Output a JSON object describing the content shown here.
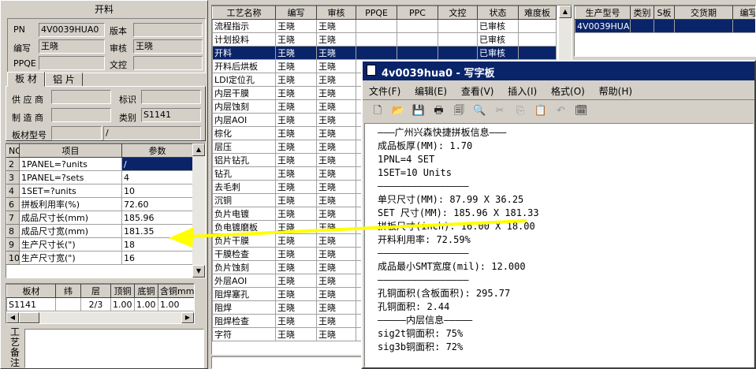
{
  "left": {
    "title": "开料",
    "pn_label": "PN",
    "pn_value": "4V0039HUA0",
    "version_label": "版本",
    "version_value": "",
    "editor_label": "编写",
    "editor_value": "王晓",
    "reviewer_label": "审核",
    "reviewer_value": "王晓",
    "ppqe_label": "PPQE",
    "ppqe_value": "",
    "doc_label": "文控",
    "doc_value": "",
    "tabs": [
      "板 材",
      "铝 片"
    ],
    "supplier_label": "供 应 商",
    "supplier_value": "",
    "mark_label": "标识",
    "mark_value": "",
    "maker_label": "制 造 商",
    "maker_value": "",
    "category_label": "类别",
    "category_value": "S1141",
    "model_label": "板材型号",
    "model_value": "",
    "model_value2": "/",
    "param_headers": [
      "NO",
      "项目",
      "参数"
    ],
    "params": [
      {
        "no": "2",
        "item": "1PANEL=?units",
        "value": "/"
      },
      {
        "no": "3",
        "item": "1PANEL=?sets",
        "value": "4"
      },
      {
        "no": "4",
        "item": "1SET=?units",
        "value": "10"
      },
      {
        "no": "6",
        "item": "拼板利用率(%)",
        "value": "72.60"
      },
      {
        "no": "7",
        "item": "成品尺寸长(mm)",
        "value": "185.96"
      },
      {
        "no": "8",
        "item": "成品尺寸宽(mm)",
        "value": "181.35"
      },
      {
        "no": "9",
        "item": "生产尺寸长(\")",
        "value": "18"
      },
      {
        "no": "10",
        "item": "生产尺寸宽(\")",
        "value": "16"
      }
    ],
    "material_headers": [
      "板材",
      "纬",
      "层",
      "顶铜",
      "底铜",
      "含铜mm"
    ],
    "material_row": [
      "S1141",
      "",
      "2/3",
      "1.00",
      "1.00",
      "1.00"
    ],
    "remarks_label": "工艺备注"
  },
  "process": {
    "headers": [
      "工艺名称",
      "编写",
      "审核",
      "PPQE",
      "PPC",
      "文控",
      "状态",
      "难度板"
    ],
    "rows": [
      {
        "name": "流程指示",
        "editor": "王晓",
        "reviewer": "王晓",
        "status": "已审核"
      },
      {
        "name": "计划投料",
        "editor": "王晓",
        "reviewer": "王晓",
        "status": "已审核"
      },
      {
        "name": "开料",
        "editor": "王晓",
        "reviewer": "王晓",
        "status": "已审核"
      },
      {
        "name": "开料后烘板",
        "editor": "王晓",
        "reviewer": "王晓",
        "status": ""
      },
      {
        "name": "LDI定位孔",
        "editor": "王晓",
        "reviewer": "王晓",
        "status": ""
      },
      {
        "name": "内层干膜",
        "editor": "王晓",
        "reviewer": "王晓",
        "status": ""
      },
      {
        "name": "内层蚀刻",
        "editor": "王晓",
        "reviewer": "王晓",
        "status": ""
      },
      {
        "name": "内层AOI",
        "editor": "王晓",
        "reviewer": "王晓",
        "status": ""
      },
      {
        "name": "棕化",
        "editor": "王晓",
        "reviewer": "王晓",
        "status": ""
      },
      {
        "name": "层压",
        "editor": "王晓",
        "reviewer": "王晓",
        "status": ""
      },
      {
        "name": "铝片钻孔",
        "editor": "王晓",
        "reviewer": "王晓",
        "status": ""
      },
      {
        "name": "钻孔",
        "editor": "王晓",
        "reviewer": "王晓",
        "status": ""
      },
      {
        "name": "去毛刺",
        "editor": "王晓",
        "reviewer": "王晓",
        "status": ""
      },
      {
        "name": "沉铜",
        "editor": "王晓",
        "reviewer": "王晓",
        "status": ""
      },
      {
        "name": "负片电镀",
        "editor": "王晓",
        "reviewer": "王晓",
        "status": ""
      },
      {
        "name": "负电镀磨板",
        "editor": "王晓",
        "reviewer": "王晓",
        "status": ""
      },
      {
        "name": "负片干膜",
        "editor": "王晓",
        "reviewer": "王晓",
        "status": ""
      },
      {
        "name": "干膜检查",
        "editor": "王晓",
        "reviewer": "王晓",
        "status": ""
      },
      {
        "name": "负片蚀刻",
        "editor": "王晓",
        "reviewer": "王晓",
        "status": ""
      },
      {
        "name": "外层AOI",
        "editor": "王晓",
        "reviewer": "王晓",
        "status": ""
      },
      {
        "name": "阻焊塞孔",
        "editor": "王晓",
        "reviewer": "王晓",
        "status": ""
      },
      {
        "name": "阻焊",
        "editor": "王晓",
        "reviewer": "王晓",
        "status": ""
      },
      {
        "name": "阻焊检查",
        "editor": "王晓",
        "reviewer": "王晓",
        "status": ""
      },
      {
        "name": "字符",
        "editor": "王晓",
        "reviewer": "王晓",
        "status": ""
      }
    ]
  },
  "orders": {
    "headers": [
      "生产型号",
      "类别",
      "S板",
      "交货期",
      "编写"
    ],
    "row": [
      "4V0039HUA0",
      "",
      "",
      "",
      ""
    ]
  },
  "notepad": {
    "title": "4v0039hua0 - 写字板",
    "menu": [
      "文件(F)",
      "编辑(E)",
      "查看(V)",
      "插入(I)",
      "格式(O)",
      "帮助(H)"
    ],
    "lines": [
      "———广州兴森快捷拼板信息———",
      "成品板厚(MM): 1.70",
      "1PNL=4 SET",
      "1SET=10 Units",
      "————————————————",
      "单只尺寸(MM): 87.99 X 36.25",
      "SET 尺寸(MM): 185.96 X 181.33",
      "拼板尺寸(inch): 16.00 X 18.00",
      "开料利用率: 72.59%",
      "————————————————",
      "成品最小SMT宽度(mil): 12.000",
      "————————————————",
      "孔铜面积(含板面积): 295.77",
      "孔铜面积: 2.44",
      "—————内层信息—————",
      "sig2t铜面积: 75%",
      "sig3b铜面积: 72%"
    ]
  },
  "accent_color": "#0a246a",
  "arrow_color": "#ffff00"
}
